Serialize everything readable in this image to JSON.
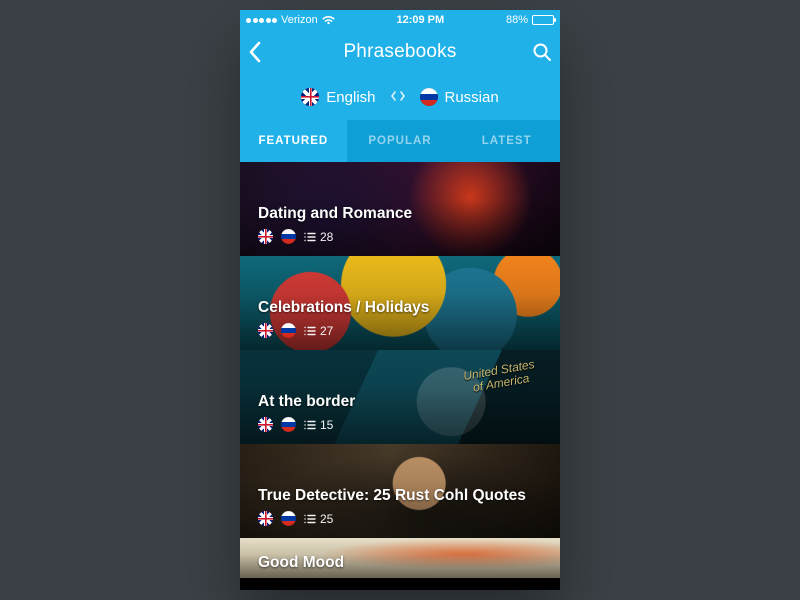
{
  "statusbar": {
    "carrier": "Verizon",
    "time": "12:09 PM",
    "battery_pct": "88%"
  },
  "nav": {
    "title": "Phrasebooks"
  },
  "lang": {
    "from": "English",
    "to": "Russian"
  },
  "tabs": {
    "featured": "FEATURED",
    "popular": "POPULAR",
    "latest": "LATEST",
    "active": "featured"
  },
  "rows": [
    {
      "title": "Dating and Romance",
      "count": "28"
    },
    {
      "title": "Celebrations / Holidays",
      "count": "27"
    },
    {
      "title": "At the border",
      "count": "15",
      "passport_top": "United States",
      "passport_bottom": "of America"
    },
    {
      "title": "True Detective: 25 Rust Cohl Quotes",
      "count": "25"
    },
    {
      "title": "Good Mood"
    }
  ]
}
